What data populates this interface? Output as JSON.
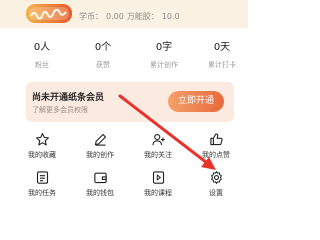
{
  "header": {
    "coins_label": "学币：",
    "coins_value": "0.00",
    "energy_label": "万能胶：",
    "energy_value": "10.0"
  },
  "stats": [
    {
      "value": "0人",
      "label": "粉丝"
    },
    {
      "value": "0个",
      "label": "获赞"
    },
    {
      "value": "0字",
      "label": "累计创作"
    },
    {
      "value": "0天",
      "label": "累计打卡"
    }
  ],
  "vip": {
    "title": "尚未开通纸条会员",
    "subtitle": "了解更多会员权限",
    "button": "立即开通"
  },
  "grid": [
    {
      "label": "我的收藏",
      "icon": "star-icon"
    },
    {
      "label": "我的创作",
      "icon": "pencil-icon"
    },
    {
      "label": "我的关注",
      "icon": "user-add-icon"
    },
    {
      "label": "我的点赞",
      "icon": "thumbs-up-icon"
    },
    {
      "label": "我的任务",
      "icon": "task-list-icon"
    },
    {
      "label": "我的钱包",
      "icon": "wallet-icon"
    },
    {
      "label": "我的课程",
      "icon": "course-icon"
    },
    {
      "label": "设置",
      "icon": "gear-icon"
    }
  ],
  "colors": {
    "accent": "#e86a3c",
    "vip_bg": "#fbeae0",
    "arrow": "#e8322b"
  }
}
